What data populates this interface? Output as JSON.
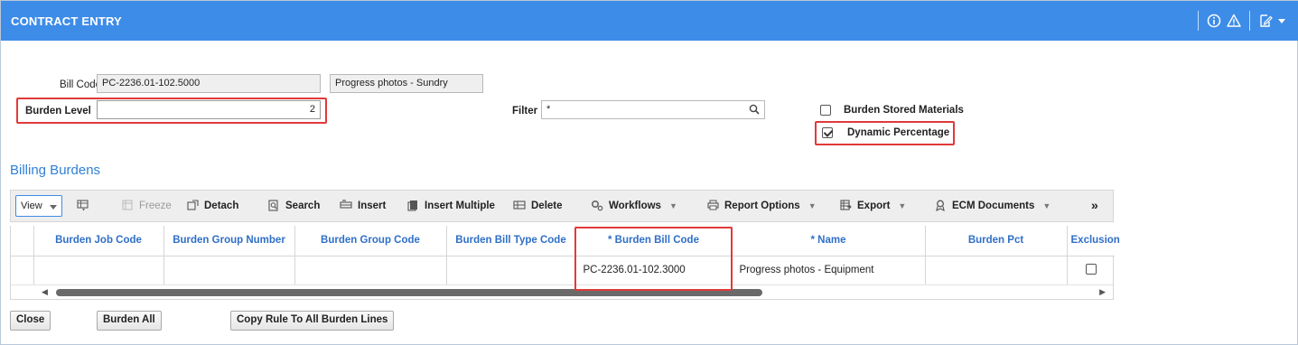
{
  "window": {
    "title": "CONTRACT ENTRY"
  },
  "header_icons": [
    "info-icon",
    "warning-icon",
    "edit-note-icon",
    "dropdown-caret-icon"
  ],
  "form": {
    "bill_code_label": "Bill Code",
    "bill_code_value": "PC-2236.01-102.5000",
    "bill_code_desc": "Progress photos - Sundry",
    "burden_level_label": "Burden Level",
    "burden_level_value": "2",
    "filter_label": "Filter",
    "filter_value": "*",
    "burden_stored_materials_label": "Burden Stored Materials",
    "burden_stored_materials_checked": false,
    "dynamic_percentage_label": "Dynamic Percentage",
    "dynamic_percentage_checked": true
  },
  "section": {
    "title": "Billing Burdens"
  },
  "toolbar": {
    "view": "View",
    "freeze": "Freeze",
    "detach": "Detach",
    "search": "Search",
    "insert": "Insert",
    "insert_multiple": "Insert Multiple",
    "delete": "Delete",
    "workflows": "Workflows",
    "report_options": "Report Options",
    "export": "Export",
    "ecm_documents": "ECM Documents",
    "more": "»"
  },
  "grid": {
    "columns": [
      "Burden Job Code",
      "Burden Group Number",
      "Burden Group Code",
      "Burden Bill Type Code",
      "* Burden Bill Code",
      "* Name",
      "Burden Pct",
      "Exclusion"
    ],
    "rows": [
      {
        "burden_job_code": "",
        "burden_group_number": "",
        "burden_group_code": "",
        "burden_bill_type_code": "",
        "burden_bill_code": "PC-2236.01-102.3000",
        "name": "Progress photos - Equipment",
        "burden_pct": "",
        "exclusion": false
      }
    ]
  },
  "buttons": {
    "close": "Close",
    "burden_all": "Burden All",
    "copy_rule": "Copy Rule To All Burden Lines"
  },
  "colors": {
    "accent": "#3d8ce8",
    "highlight": "#e03a3a",
    "column_header": "#2f6fc7"
  }
}
